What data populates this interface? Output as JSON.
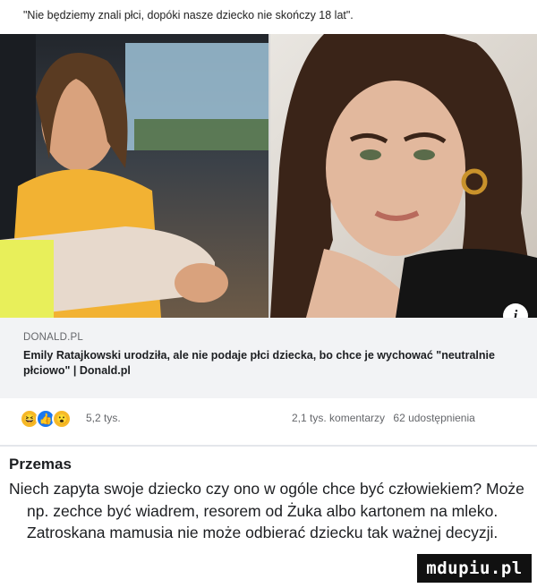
{
  "post": {
    "quote_text": "\"Nie będziemy znali płci, dopóki nasze dziecko nie skończy 18 lat\"."
  },
  "link_preview": {
    "domain": "DONALD.PL",
    "title": "Emily Ratajkowski urodziła, ale nie podaje płci dziecka, bo chce je wychować \"neutralnie płciowo\" | Donald.pl",
    "info_icon": "info-icon"
  },
  "engagement": {
    "reactions": [
      "haha-emoji",
      "like-icon",
      "wow-emoji"
    ],
    "reaction_count": "5,2 tys.",
    "comments_count": "2,1 tys. komentarzy",
    "shares_count": "62 udostępnienia"
  },
  "comment": {
    "author": "Przemas",
    "text": "Niech zapyta swoje dziecko czy ono w ogóle chce być człowiekiem? Może np. zechce być wiadrem, resorem od Żuka albo kartonem na mleko. Zatroskana mamusia nie może odbierać dziecku tak ważnej decyzji."
  },
  "watermark": {
    "text": "mdupiu.pl"
  },
  "colors": {
    "link_background": "#f2f3f5",
    "like_blue": "#1877f2",
    "emoji_yellow": "#f7b928",
    "secondary_text": "#65676b"
  }
}
